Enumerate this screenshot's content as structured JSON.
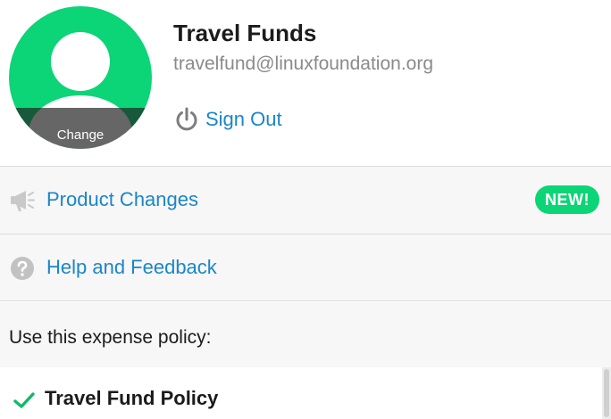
{
  "profile": {
    "name": "Travel Funds",
    "email": "travelfund@linuxfoundation.org",
    "avatar_change_label": "Change",
    "avatar_icon": "person-silhouette-icon",
    "avatar_color": "#0bd576",
    "sign_out_label": "Sign Out",
    "sign_out_icon": "power-icon"
  },
  "menu": [
    {
      "label": "Product Changes",
      "icon": "megaphone-icon",
      "badge": "NEW!"
    },
    {
      "label": "Help and Feedback",
      "icon": "question-circle-icon"
    }
  ],
  "policy": {
    "heading": "Use this expense policy:",
    "items": [
      {
        "name": "Travel Fund Policy",
        "selected": true,
        "icon": "check-icon"
      }
    ]
  },
  "colors": {
    "accent": "#1a86c8",
    "brand_green": "#0bd576",
    "text_dark": "#1b1b1b",
    "text_muted": "#8a8a8a",
    "row_background": "#f7f7f7"
  }
}
